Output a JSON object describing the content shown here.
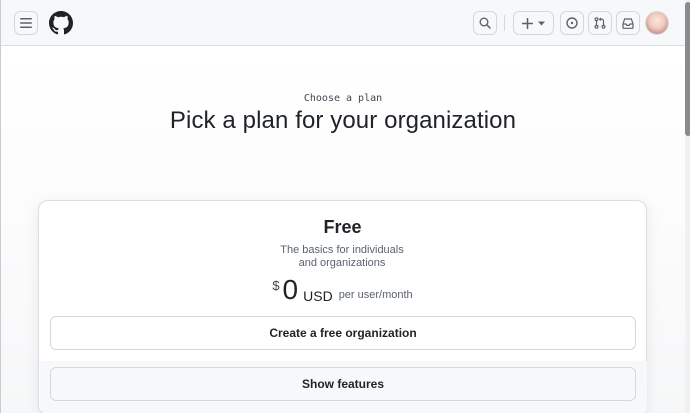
{
  "header": {
    "icons": {
      "menu": "hamburger-icon",
      "logo": "github-logo-icon",
      "search": "search-icon",
      "create": "plus-icon",
      "issues": "issue-opened-icon",
      "pulls": "git-pull-request-icon",
      "inbox": "inbox-icon"
    }
  },
  "main": {
    "eyebrow": "Choose a plan",
    "title": "Pick a plan for your organization"
  },
  "plan": {
    "name": "Free",
    "description_line1": "The basics for individuals",
    "description_line2": "and organizations",
    "currency_symbol": "$",
    "amount": "0",
    "currency": "USD",
    "period": "per user/month",
    "create_label": "Create a free organization",
    "features_label": "Show features"
  },
  "colors": {
    "header_bg": "#f6f8fa",
    "text": "#1f2328",
    "muted": "#59636e",
    "border": "#d1d9e0"
  }
}
